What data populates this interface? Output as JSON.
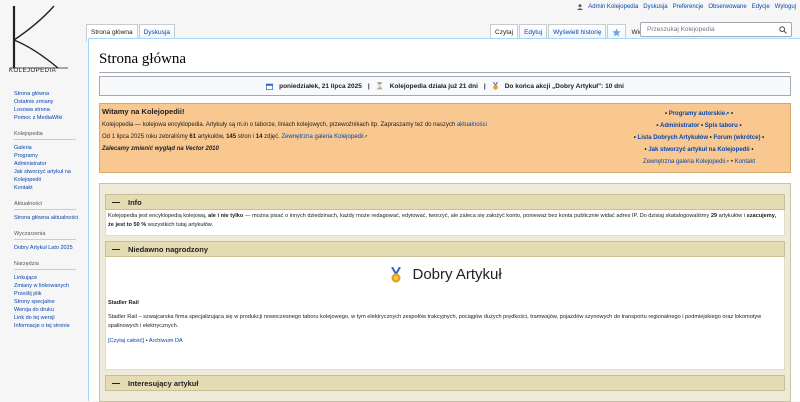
{
  "logo": {
    "text": "KOLEJOPEDIA"
  },
  "personal": [
    "Admin Kolejopedia",
    "Dyskusja",
    "Preferencje",
    "Obserwowane",
    "Edycje",
    "Wyloguj"
  ],
  "tabs_left": [
    "Strona główna",
    "Dyskusja"
  ],
  "tabs_right": [
    "Czytaj",
    "Edytuj",
    "Wyświetl historię"
  ],
  "more_label": "Więcej",
  "search": {
    "placeholder": "Przeszukaj Kolejopedia"
  },
  "sidebar": {
    "nav": [
      "Strona główna",
      "Ostatnie zmiany",
      "Losowa strona",
      "Pomoc z MediaWiki"
    ],
    "kolejopedia_heading": "Kolejopedia",
    "kolejopedia": [
      "Galeria",
      "Programy",
      "Administrator",
      "Jak stworzyć artykuł na Kolejopedii",
      "Kontakt"
    ],
    "aktualnosci_heading": "Aktualności",
    "aktualnosci": [
      "Strona główna aktualności"
    ],
    "wyczarzenia_heading": "Wyczarzenia",
    "wyczarzenia": [
      "Dobry Artykuł Lato 2025"
    ],
    "narzedzia_heading": "Narzędzia",
    "narzedzia": [
      "Linkujące",
      "Zmiany w linkowanych",
      "Prześlij plik",
      "Strony specjalne",
      "Wersja do druku",
      "Link do tej wersji",
      "Informacje o tej stronie"
    ]
  },
  "page": {
    "title": "Strona główna"
  },
  "infobar": {
    "date": "poniedziałek, 21 lipca 2025",
    "days": "Kolejopedia działa już 21 dni",
    "action": "Do końca akcji „Dobry Artykuł\": 10 dni",
    "sep": "|"
  },
  "welcome": {
    "title": "Witamy na Kolejopedii!",
    "p1_a": "Kolejopedia — kolejowa encyklopedia. Artykuły są m.in o taborze, liniach kolejowych, przewoźnikach itp. Zapraszamy też do naszych ",
    "p1_link": "aktualności",
    "p2_a": "Od 1 lipca 2025 roku zebraliśmy ",
    "p2_b1": "61",
    "p2_c": " artykułów, ",
    "p2_b2": "145",
    "p2_d": " stron i ",
    "p2_b3": "14",
    "p2_e": " zdjęć. ",
    "p2_link": "Zewnętrzna galeria Kolejopedii",
    "p3": "Zalecamy zmienić wygląd na Vector 2010",
    "links": {
      "programy": "Programy autorskie",
      "administrator": "Administrator",
      "spis": "Spis taboru",
      "lista": "Lista Dobrych Artykułów",
      "forum": "Forum (wkrótce)",
      "jak": "Jak stworzyć artykuł na Kolejopedii",
      "galeria": "Zewnętrzna galeria Kolejopedii",
      "kontakt": "Kontakt",
      "bullet": "•"
    }
  },
  "sections": {
    "info_title": "Info",
    "info_text_a": "Kolejopedia jest encyklopedią kolejową, ",
    "info_text_b": "ale i nie tylko",
    "info_text_c": " — można pisać o innych dziedzinach, każdy może redagować, edytować, tworzyć, ale zaleca się założyć konto, ponieważ bez konta publicznie widać adres IP. Do dzisiaj skatalogowaliśmy ",
    "info_text_d": "29",
    "info_text_e": " artykułów i ",
    "info_text_f": "szacujemy, że jest to 50 %",
    "info_text_g": " wszystkich tutaj artykułów.",
    "nagrodzony_title": "Niedawno nagrodzony",
    "da_label": "Dobry Artykuł",
    "article_name": "Stadler Rail",
    "article_text": "Stadler Rail – szwajcarska firma specjalizująca się w produkcji nowoczesnego taboru kolejowego, w tym elektrycznych zespołów trakcyjnych, pociągów dużych prędkości, tramwajów, pojazdów szynowych do transportu regionalnego i podmiejskiego oraz lokomotyw spalinowych i elektrycznych.",
    "read_more": "[Czytaj całość]",
    "archive": "Archiwum DA",
    "ciekawy_title": "Interesujący artykuł"
  },
  "colors": {
    "welcome_bg": "#f8c890",
    "section_bg": "#e6dcb4",
    "link": "#0645ad"
  }
}
